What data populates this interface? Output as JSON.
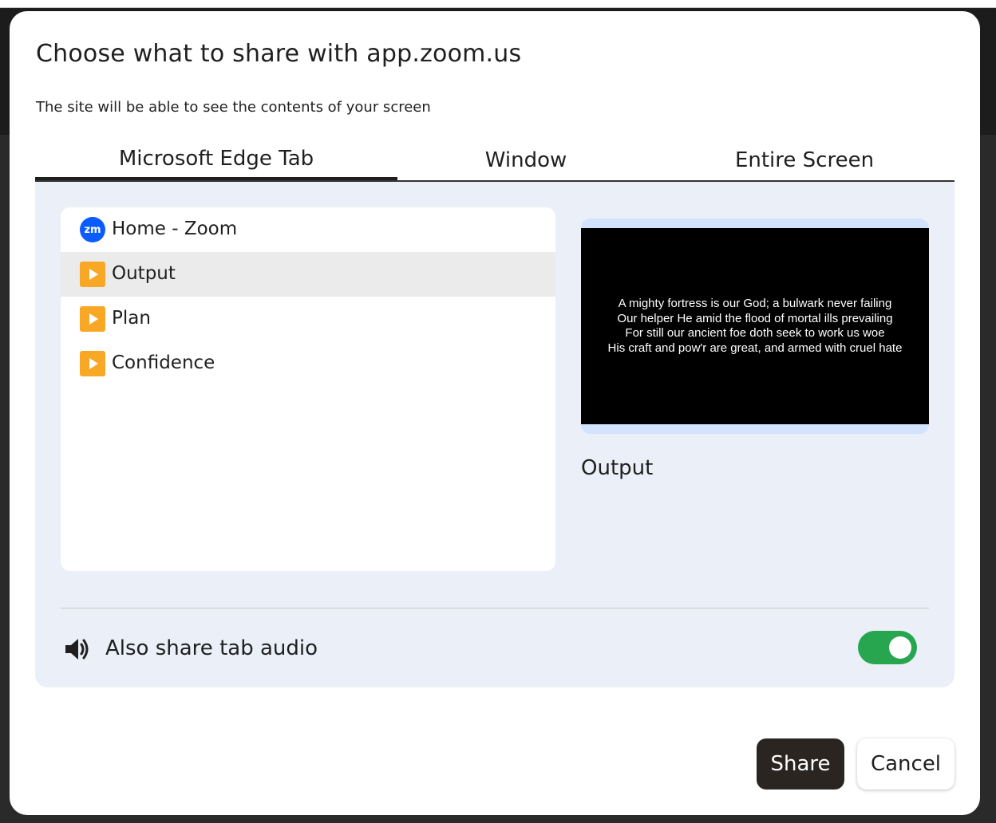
{
  "dialog": {
    "title": "Choose what to share with app.zoom.us",
    "subtitle": "The site will be able to see the contents of your screen"
  },
  "tabs": [
    {
      "label": "Microsoft Edge Tab",
      "active": true
    },
    {
      "label": "Window",
      "active": false
    },
    {
      "label": "Entire Screen",
      "active": false
    }
  ],
  "tab_list": [
    {
      "label": "Home - Zoom",
      "icon": "zoom-icon",
      "selected": false
    },
    {
      "label": "Output",
      "icon": "play-icon",
      "selected": true
    },
    {
      "label": "Plan",
      "icon": "play-icon",
      "selected": false
    },
    {
      "label": "Confidence",
      "icon": "play-icon",
      "selected": false
    }
  ],
  "zoom_icon_text": "zm",
  "preview": {
    "lines": [
      "A mighty fortress is our God; a bulwark never failing",
      "Our helper He amid the flood of mortal ills prevailing",
      "For still our ancient foe doth seek to work us woe",
      "His craft and pow'r are great, and armed with cruel hate"
    ],
    "label": "Output"
  },
  "audio": {
    "label": "Also share tab audio",
    "icon": "speaker-icon",
    "enabled": true
  },
  "buttons": {
    "share": "Share",
    "cancel": "Cancel"
  },
  "colors": {
    "accent_toggle": "#27a54f",
    "panel_bg": "#eaeff8",
    "preview_frame": "#d3e3fd",
    "zoom_blue": "#0b5cff",
    "play_orange": "#f9a825",
    "share_button": "#2b2522"
  }
}
